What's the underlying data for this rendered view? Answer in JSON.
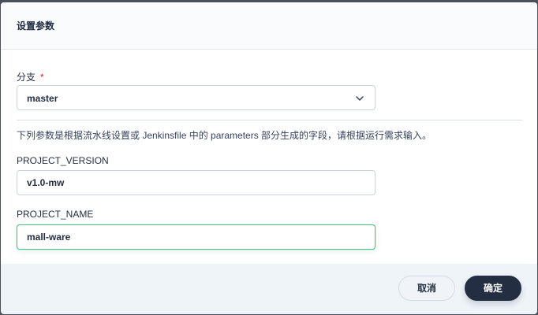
{
  "dialog": {
    "title": "设置参数"
  },
  "branch": {
    "label": "分支",
    "required_mark": "*",
    "value": "master",
    "chevron_icon": "chevron-down-icon"
  },
  "hint": "下列参数是根据流水线设置或 Jenkinsfile 中的 parameters 部分生成的字段，请根据运行需求输入。",
  "params": [
    {
      "label": "PROJECT_VERSION",
      "value": "v1.0-mw"
    },
    {
      "label": "PROJECT_NAME",
      "value": "mall-ware"
    }
  ],
  "footer": {
    "cancel_label": "取消",
    "confirm_label": "确定"
  },
  "colors": {
    "focus_border": "#55bc8a",
    "primary_button": "#242e42",
    "required": "#ca2621"
  }
}
